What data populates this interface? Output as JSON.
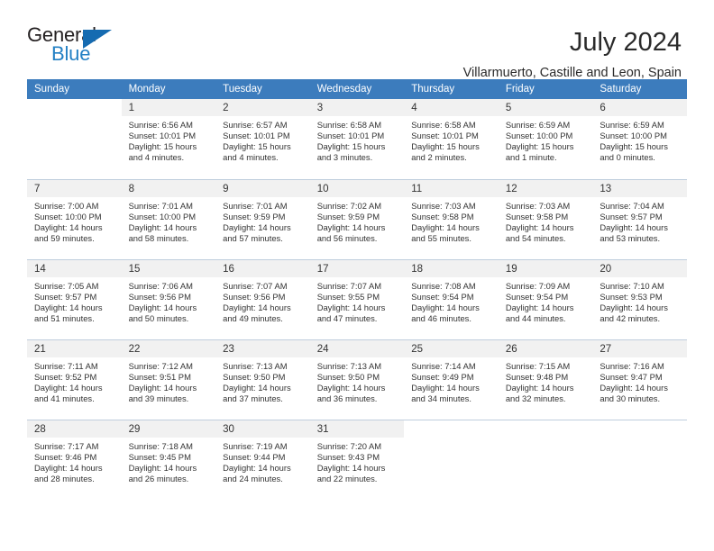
{
  "logo": {
    "word1": "General",
    "word2": "Blue",
    "triangle_icon": "triangle-icon",
    "brand_blue": "#2380c4"
  },
  "header": {
    "month_title": "July 2024",
    "location": "Villarmuerto, Castille and Leon, Spain"
  },
  "theme": {
    "header_blue": "#3c7cbd",
    "daynum_gray": "#f1f1f1",
    "row_divider": "#bfcedd"
  },
  "weekdays": [
    "Sunday",
    "Monday",
    "Tuesday",
    "Wednesday",
    "Thursday",
    "Friday",
    "Saturday"
  ],
  "weeks": [
    [
      {
        "day": "",
        "empty": true,
        "sunrise": "",
        "sunset": "",
        "daylight1": "",
        "daylight2": ""
      },
      {
        "day": "1",
        "sunrise": "Sunrise: 6:56 AM",
        "sunset": "Sunset: 10:01 PM",
        "daylight1": "Daylight: 15 hours",
        "daylight2": "and 4 minutes."
      },
      {
        "day": "2",
        "sunrise": "Sunrise: 6:57 AM",
        "sunset": "Sunset: 10:01 PM",
        "daylight1": "Daylight: 15 hours",
        "daylight2": "and 4 minutes."
      },
      {
        "day": "3",
        "sunrise": "Sunrise: 6:58 AM",
        "sunset": "Sunset: 10:01 PM",
        "daylight1": "Daylight: 15 hours",
        "daylight2": "and 3 minutes."
      },
      {
        "day": "4",
        "sunrise": "Sunrise: 6:58 AM",
        "sunset": "Sunset: 10:01 PM",
        "daylight1": "Daylight: 15 hours",
        "daylight2": "and 2 minutes."
      },
      {
        "day": "5",
        "sunrise": "Sunrise: 6:59 AM",
        "sunset": "Sunset: 10:00 PM",
        "daylight1": "Daylight: 15 hours",
        "daylight2": "and 1 minute."
      },
      {
        "day": "6",
        "sunrise": "Sunrise: 6:59 AM",
        "sunset": "Sunset: 10:00 PM",
        "daylight1": "Daylight: 15 hours",
        "daylight2": "and 0 minutes."
      }
    ],
    [
      {
        "day": "7",
        "sunrise": "Sunrise: 7:00 AM",
        "sunset": "Sunset: 10:00 PM",
        "daylight1": "Daylight: 14 hours",
        "daylight2": "and 59 minutes."
      },
      {
        "day": "8",
        "sunrise": "Sunrise: 7:01 AM",
        "sunset": "Sunset: 10:00 PM",
        "daylight1": "Daylight: 14 hours",
        "daylight2": "and 58 minutes."
      },
      {
        "day": "9",
        "sunrise": "Sunrise: 7:01 AM",
        "sunset": "Sunset: 9:59 PM",
        "daylight1": "Daylight: 14 hours",
        "daylight2": "and 57 minutes."
      },
      {
        "day": "10",
        "sunrise": "Sunrise: 7:02 AM",
        "sunset": "Sunset: 9:59 PM",
        "daylight1": "Daylight: 14 hours",
        "daylight2": "and 56 minutes."
      },
      {
        "day": "11",
        "sunrise": "Sunrise: 7:03 AM",
        "sunset": "Sunset: 9:58 PM",
        "daylight1": "Daylight: 14 hours",
        "daylight2": "and 55 minutes."
      },
      {
        "day": "12",
        "sunrise": "Sunrise: 7:03 AM",
        "sunset": "Sunset: 9:58 PM",
        "daylight1": "Daylight: 14 hours",
        "daylight2": "and 54 minutes."
      },
      {
        "day": "13",
        "sunrise": "Sunrise: 7:04 AM",
        "sunset": "Sunset: 9:57 PM",
        "daylight1": "Daylight: 14 hours",
        "daylight2": "and 53 minutes."
      }
    ],
    [
      {
        "day": "14",
        "sunrise": "Sunrise: 7:05 AM",
        "sunset": "Sunset: 9:57 PM",
        "daylight1": "Daylight: 14 hours",
        "daylight2": "and 51 minutes."
      },
      {
        "day": "15",
        "sunrise": "Sunrise: 7:06 AM",
        "sunset": "Sunset: 9:56 PM",
        "daylight1": "Daylight: 14 hours",
        "daylight2": "and 50 minutes."
      },
      {
        "day": "16",
        "sunrise": "Sunrise: 7:07 AM",
        "sunset": "Sunset: 9:56 PM",
        "daylight1": "Daylight: 14 hours",
        "daylight2": "and 49 minutes."
      },
      {
        "day": "17",
        "sunrise": "Sunrise: 7:07 AM",
        "sunset": "Sunset: 9:55 PM",
        "daylight1": "Daylight: 14 hours",
        "daylight2": "and 47 minutes."
      },
      {
        "day": "18",
        "sunrise": "Sunrise: 7:08 AM",
        "sunset": "Sunset: 9:54 PM",
        "daylight1": "Daylight: 14 hours",
        "daylight2": "and 46 minutes."
      },
      {
        "day": "19",
        "sunrise": "Sunrise: 7:09 AM",
        "sunset": "Sunset: 9:54 PM",
        "daylight1": "Daylight: 14 hours",
        "daylight2": "and 44 minutes."
      },
      {
        "day": "20",
        "sunrise": "Sunrise: 7:10 AM",
        "sunset": "Sunset: 9:53 PM",
        "daylight1": "Daylight: 14 hours",
        "daylight2": "and 42 minutes."
      }
    ],
    [
      {
        "day": "21",
        "sunrise": "Sunrise: 7:11 AM",
        "sunset": "Sunset: 9:52 PM",
        "daylight1": "Daylight: 14 hours",
        "daylight2": "and 41 minutes."
      },
      {
        "day": "22",
        "sunrise": "Sunrise: 7:12 AM",
        "sunset": "Sunset: 9:51 PM",
        "daylight1": "Daylight: 14 hours",
        "daylight2": "and 39 minutes."
      },
      {
        "day": "23",
        "sunrise": "Sunrise: 7:13 AM",
        "sunset": "Sunset: 9:50 PM",
        "daylight1": "Daylight: 14 hours",
        "daylight2": "and 37 minutes."
      },
      {
        "day": "24",
        "sunrise": "Sunrise: 7:13 AM",
        "sunset": "Sunset: 9:50 PM",
        "daylight1": "Daylight: 14 hours",
        "daylight2": "and 36 minutes."
      },
      {
        "day": "25",
        "sunrise": "Sunrise: 7:14 AM",
        "sunset": "Sunset: 9:49 PM",
        "daylight1": "Daylight: 14 hours",
        "daylight2": "and 34 minutes."
      },
      {
        "day": "26",
        "sunrise": "Sunrise: 7:15 AM",
        "sunset": "Sunset: 9:48 PM",
        "daylight1": "Daylight: 14 hours",
        "daylight2": "and 32 minutes."
      },
      {
        "day": "27",
        "sunrise": "Sunrise: 7:16 AM",
        "sunset": "Sunset: 9:47 PM",
        "daylight1": "Daylight: 14 hours",
        "daylight2": "and 30 minutes."
      }
    ],
    [
      {
        "day": "28",
        "sunrise": "Sunrise: 7:17 AM",
        "sunset": "Sunset: 9:46 PM",
        "daylight1": "Daylight: 14 hours",
        "daylight2": "and 28 minutes."
      },
      {
        "day": "29",
        "sunrise": "Sunrise: 7:18 AM",
        "sunset": "Sunset: 9:45 PM",
        "daylight1": "Daylight: 14 hours",
        "daylight2": "and 26 minutes."
      },
      {
        "day": "30",
        "sunrise": "Sunrise: 7:19 AM",
        "sunset": "Sunset: 9:44 PM",
        "daylight1": "Daylight: 14 hours",
        "daylight2": "and 24 minutes."
      },
      {
        "day": "31",
        "sunrise": "Sunrise: 7:20 AM",
        "sunset": "Sunset: 9:43 PM",
        "daylight1": "Daylight: 14 hours",
        "daylight2": "and 22 minutes."
      },
      {
        "day": "",
        "empty": true,
        "sunrise": "",
        "sunset": "",
        "daylight1": "",
        "daylight2": ""
      },
      {
        "day": "",
        "empty": true,
        "sunrise": "",
        "sunset": "",
        "daylight1": "",
        "daylight2": ""
      },
      {
        "day": "",
        "empty": true,
        "sunrise": "",
        "sunset": "",
        "daylight1": "",
        "daylight2": ""
      }
    ]
  ]
}
